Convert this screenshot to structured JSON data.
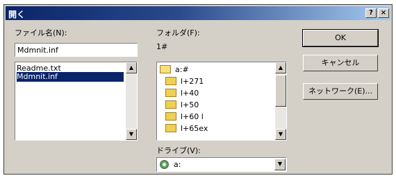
{
  "window": {
    "title": "開く",
    "help_label": "?",
    "close_label": "×"
  },
  "filename": {
    "label": "ファイル名(N):",
    "value": "Mdmnit.inf",
    "files": [
      "Readme.txt",
      "Mdmnit.inf"
    ],
    "selected_index": 1
  },
  "folder": {
    "label": "フォルダ(F):",
    "current": "1#",
    "items": [
      "a:#",
      "l+271",
      "l+40",
      "l+50",
      "l+60 l",
      "l+65ex"
    ]
  },
  "drives": {
    "label": "ドライブ(V):",
    "value": "a:"
  },
  "buttons": {
    "ok": "OK",
    "cancel": "キャンセル",
    "network": "ネットワーク(E)..."
  },
  "colors": {
    "titlebar_start": "#0a246a",
    "titlebar_end": "#a6caf0",
    "selection": "#0a246a",
    "face": "#d4d0c8"
  }
}
